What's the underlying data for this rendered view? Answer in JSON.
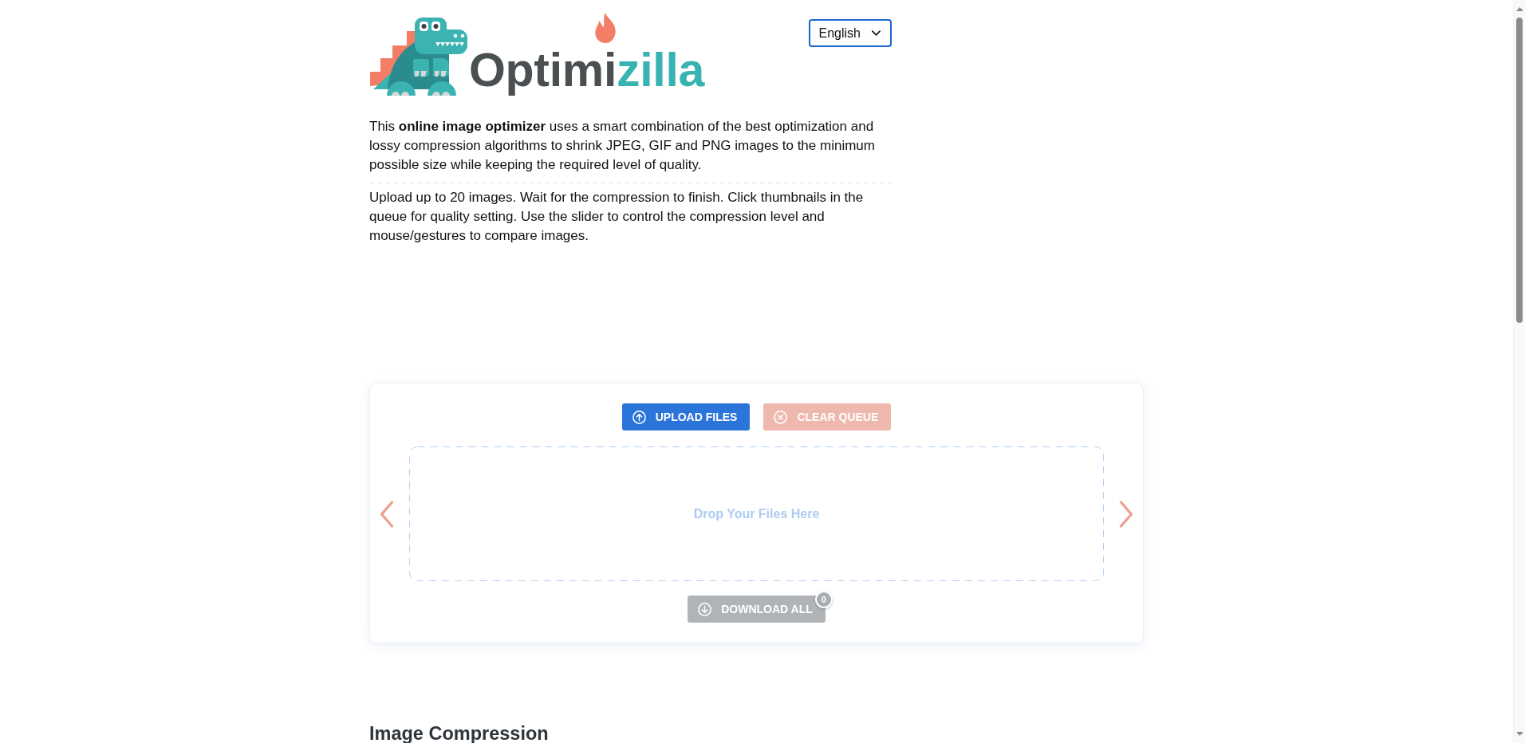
{
  "logo": {
    "wordmark": [
      "Optimi",
      "zilla"
    ]
  },
  "language_select": {
    "value": "English"
  },
  "intro": [
    "This **online image optimizer** uses a smart combination of the best optimization and lossy compression algorithms to shrink JPEG, GIF and PNG images to the minimum possible size while keeping the required level of quality.",
    "Upload up to 20 images. Wait for the compression to finish. Click thumbnails in the queue for quality setting. Use the slider to control the compression level and mouse/gestures to compare images."
  ],
  "uploader": {
    "buttons": [
      {
        "label": "UPLOAD FILES",
        "kind": "upload",
        "disabled": false
      },
      {
        "label": "CLEAR QUEUE",
        "kind": "clear",
        "disabled": true
      }
    ],
    "dropzone": {
      "text": "Drop Your Files Here"
    },
    "download_all": {
      "label": "DOWNLOAD ALL",
      "disabled": true,
      "count": "0"
    }
  },
  "section_heading": "Image Compression"
}
